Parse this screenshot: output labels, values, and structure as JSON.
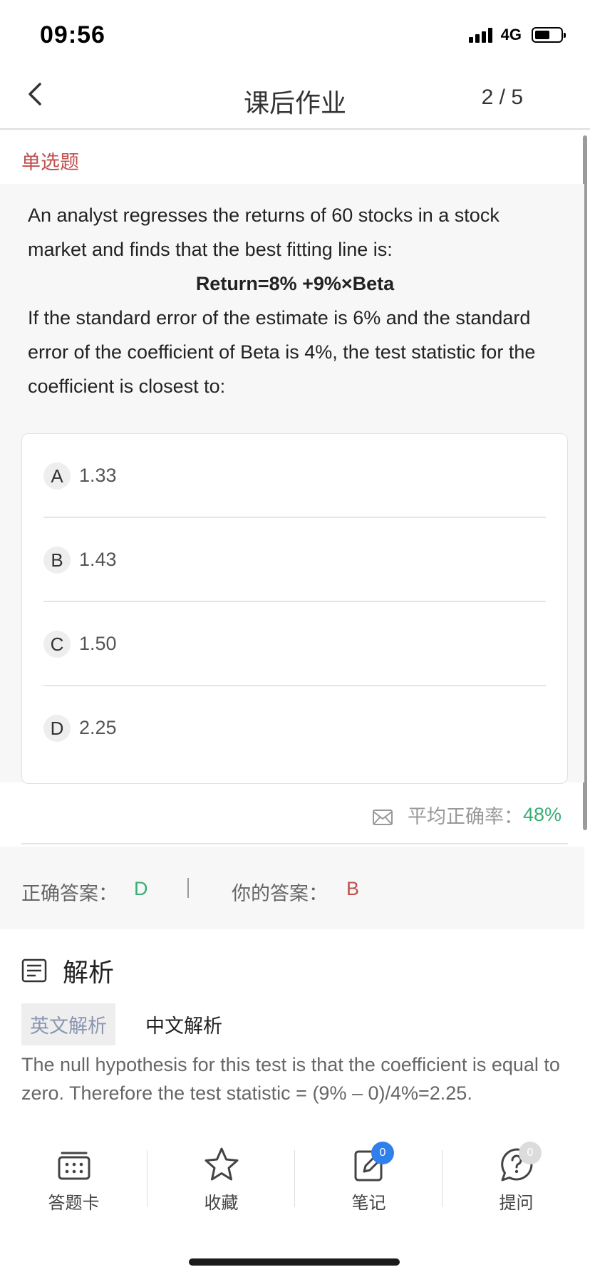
{
  "status_bar": {
    "time": "09:56",
    "network": "4G"
  },
  "nav": {
    "title": "课后作业",
    "progress": "2 / 5"
  },
  "question": {
    "type": "单选题",
    "text_1": "An analyst regresses the returns of 60 stocks in a stock market and finds that the best fitting line is:",
    "formula": "Return=8% +9%×Beta",
    "text_2": "If the standard error of the estimate is 6% and the standard error of the coefficient of Beta is 4%, the test statistic for the coefficient is closest to:"
  },
  "options": [
    {
      "letter": "A",
      "value": "1.33"
    },
    {
      "letter": "B",
      "value": "1.43"
    },
    {
      "letter": "C",
      "value": "1.50"
    },
    {
      "letter": "D",
      "value": "2.25"
    }
  ],
  "stats": {
    "accuracy_label": "平均正确率：",
    "accuracy_value": "48%"
  },
  "answers": {
    "correct_label": "正确答案：",
    "correct_value": "D",
    "your_label": "你的答案：",
    "your_value": "B"
  },
  "analysis": {
    "title": "解析",
    "tab_english": "英文解析",
    "tab_chinese": "中文解析",
    "text": "The null hypothesis for this test is that the coefficient is equal to zero. Therefore the test statistic = (9% – 0)/4%=2.25."
  },
  "bottom_bar": {
    "answer_card": "答题卡",
    "favorite": "收藏",
    "notes": "笔记",
    "notes_count": "0",
    "ask": "提问",
    "ask_count": "0"
  },
  "colors": {
    "correct_green": "#3aae74",
    "wrong_red": "#c0504d",
    "badge_blue": "#2f80ed"
  }
}
